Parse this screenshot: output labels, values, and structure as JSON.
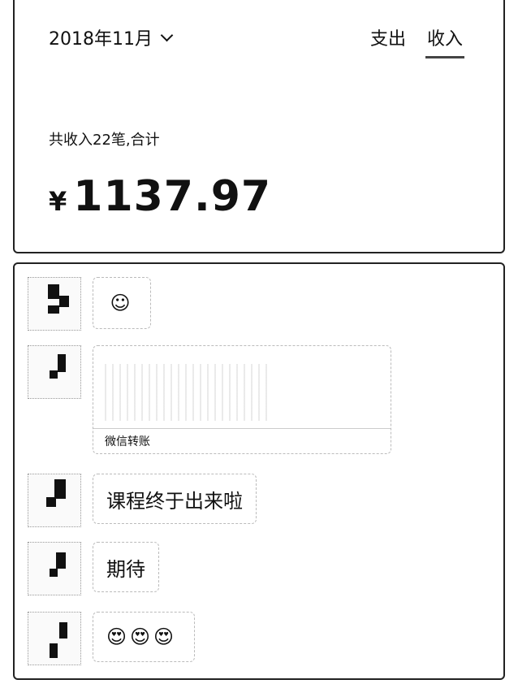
{
  "header": {
    "month_label": "2018年11月",
    "tabs": [
      {
        "label": "支出",
        "active": false
      },
      {
        "label": "收入",
        "active": true
      }
    ]
  },
  "summary": {
    "text": "共收入22笔,合计",
    "currency": "¥",
    "amount": "1137.97"
  },
  "chat": {
    "messages": [
      {
        "type": "emoji",
        "text": "☺"
      },
      {
        "type": "transfer",
        "footer": "微信转账"
      },
      {
        "type": "text",
        "text": "课程终于出来啦"
      },
      {
        "type": "text",
        "text": "期待"
      },
      {
        "type": "emoji",
        "text": "😍😍😍"
      }
    ]
  },
  "icons": {
    "dropdown": "chevron-down-icon",
    "avatar": "avatar-image"
  }
}
